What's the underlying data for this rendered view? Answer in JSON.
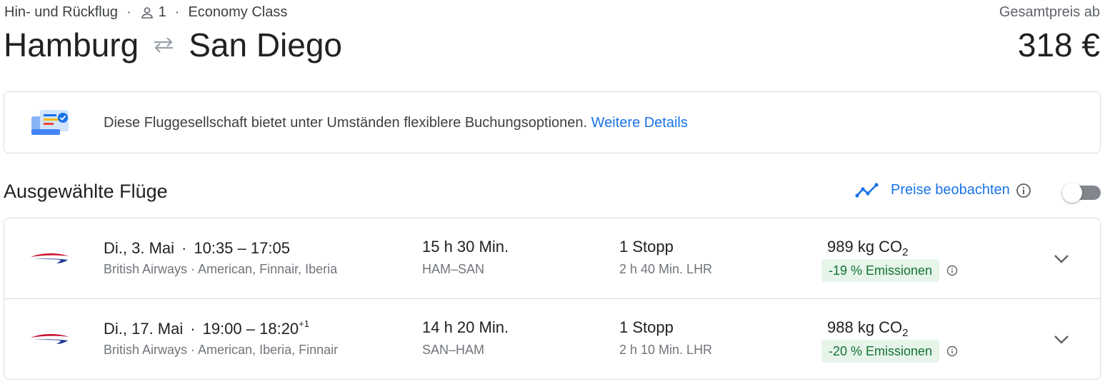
{
  "header": {
    "trip_type": "Hin- und Rückflug",
    "passengers": "1",
    "cabin": "Economy Class",
    "origin": "Hamburg",
    "destination": "San Diego",
    "price_label": "Gesamtpreis ab",
    "price": "318 €"
  },
  "notice": {
    "text": "Diese Fluggesellschaft bietet unter Umständen flexiblere Buchungsoptionen.",
    "link": "Weitere Details"
  },
  "section": {
    "title": "Ausgewählte Flüge",
    "watch_label": "Preise beobachten",
    "watch_enabled": false
  },
  "flights": [
    {
      "date": "Di., 3. Mai",
      "times": "10:35 – 17:05",
      "next_day": "",
      "airline": "British Airways",
      "partners": "American, Finnair, Iberia",
      "duration": "15 h 30 Min.",
      "route": "HAM–SAN",
      "stops": "1 Stopp",
      "layover": "2 h 40 Min. LHR",
      "co2_value": "989 kg CO",
      "co2_sub": "2",
      "emissions": "-19 % Emissionen"
    },
    {
      "date": "Di., 17. Mai",
      "times": "19:00 – 18:20",
      "next_day": "+1",
      "airline": "British Airways",
      "partners": "American, Iberia, Finnair",
      "duration": "14 h 20 Min.",
      "route": "SAN–HAM",
      "stops": "1 Stopp",
      "layover": "2 h 10 Min. LHR",
      "co2_value": "988 kg CO",
      "co2_sub": "2",
      "emissions": "-20 % Emissionen"
    }
  ],
  "icons": {
    "person": "person-icon",
    "swap": "swap-arrows-icon",
    "notice": "flexible-booking-icon",
    "trend": "price-trend-icon",
    "info": "info-icon",
    "airline_logo": "british-airways-logo",
    "expand": "chevron-down-icon"
  },
  "colors": {
    "link": "#1a73e8",
    "emissions_bg": "#e6f4ea",
    "emissions_text": "#137333",
    "border": "#dadce0"
  }
}
